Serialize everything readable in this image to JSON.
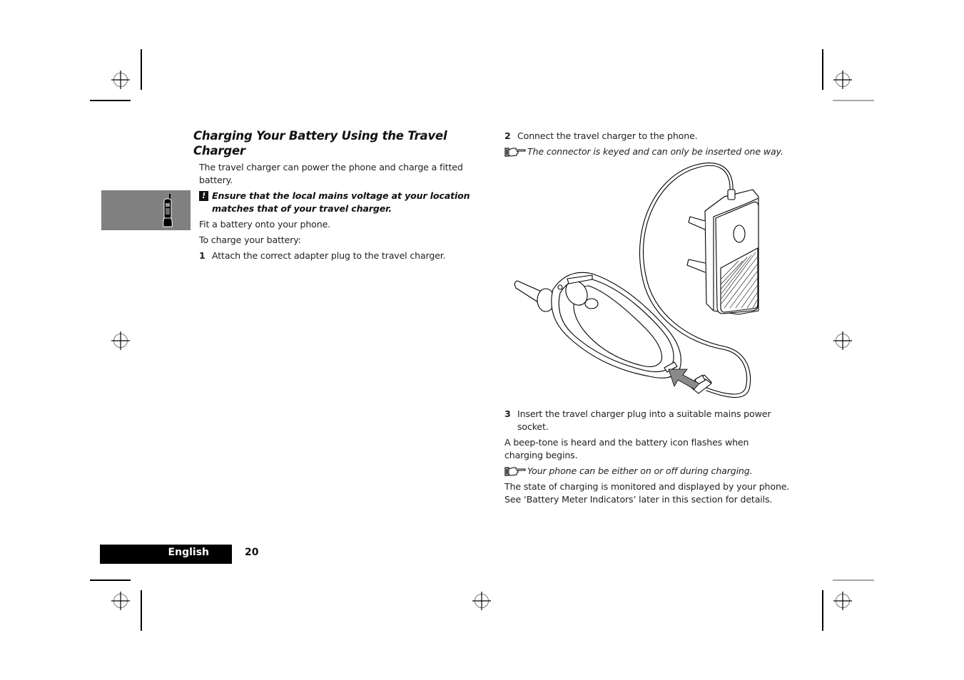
{
  "section": {
    "title": "Charging Your Battery Using the Travel Charger",
    "intro": "The travel charger can power the phone and charge a fitted battery.",
    "warning": "Ensure that the local mains voltage at your location matches that of your travel charger.",
    "fit_battery": "Fit a battery onto your phone.",
    "to_charge": "To charge your battery:",
    "steps": [
      {
        "number": "1",
        "text": "Attach the correct adapter plug to the travel charger."
      },
      {
        "number": "2",
        "text": "Connect the travel charger to the phone."
      },
      {
        "number": "3",
        "text": "Insert the travel charger plug into a suitable mains power socket."
      }
    ],
    "note_connector": "The connector is keyed and can only be inserted one way.",
    "beep_text": "A beep-tone is heard and the battery icon flashes when charging begins.",
    "note_on_off": "Your phone can be either on or off during charging.",
    "state_text": "The state of charging is monitored and displayed by your phone. See ‘Battery Meter Indicators’ later in this section for details."
  },
  "icons": {
    "warning": "!",
    "sidebar_tab": "mobile-phone-icon",
    "note": "pointing-hand-note-icon"
  },
  "footer": {
    "language": "English",
    "page_number": "20"
  },
  "colors": {
    "sidebar_tab": "#808080",
    "footer_bar": "#000000",
    "arrow": "#8a8a8a"
  }
}
